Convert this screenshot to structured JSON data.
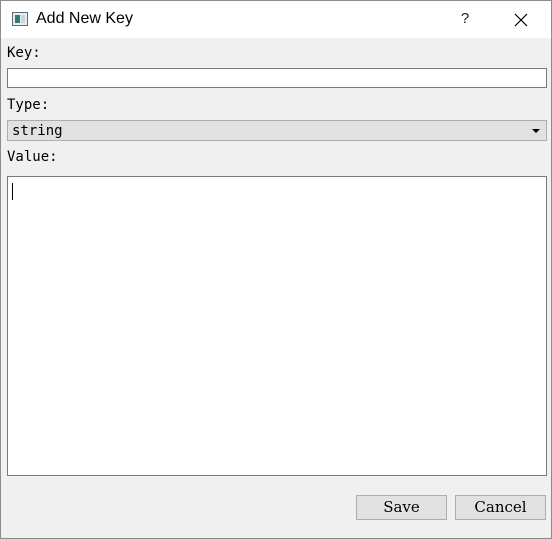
{
  "window": {
    "title": "Add New Key",
    "help_label": "?"
  },
  "form": {
    "key_label": "Key:",
    "key_value": "",
    "type_label": "Type:",
    "type_selected": "string",
    "value_label": "Value:",
    "value_text": ""
  },
  "buttons": {
    "save": "Save",
    "cancel": "Cancel"
  },
  "icons": {
    "app": "app-window-icon",
    "help": "help-icon",
    "close": "close-icon",
    "dropdown": "chevron-down-icon"
  }
}
